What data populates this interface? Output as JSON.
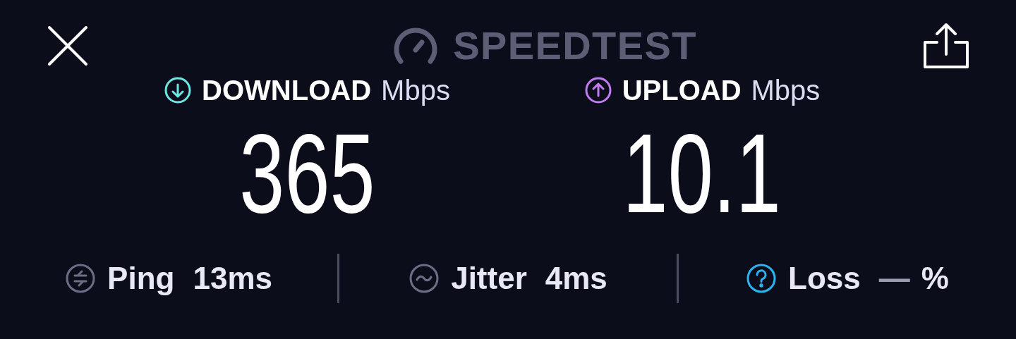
{
  "header": {
    "title": "SPEEDTEST"
  },
  "metrics": [
    {
      "kind": "download",
      "label": "DOWNLOAD",
      "unit": "Mbps",
      "value": "365",
      "color": "#6ee7e3"
    },
    {
      "kind": "upload",
      "label": "UPLOAD",
      "unit": "Mbps",
      "value": "10.1",
      "color": "#c27cf2"
    }
  ],
  "stats": [
    {
      "kind": "ping",
      "label": "Ping",
      "value": "13ms"
    },
    {
      "kind": "jitter",
      "label": "Jitter",
      "value": "4ms"
    },
    {
      "kind": "loss",
      "label": "Loss",
      "value": "—",
      "unit": "%"
    }
  ]
}
